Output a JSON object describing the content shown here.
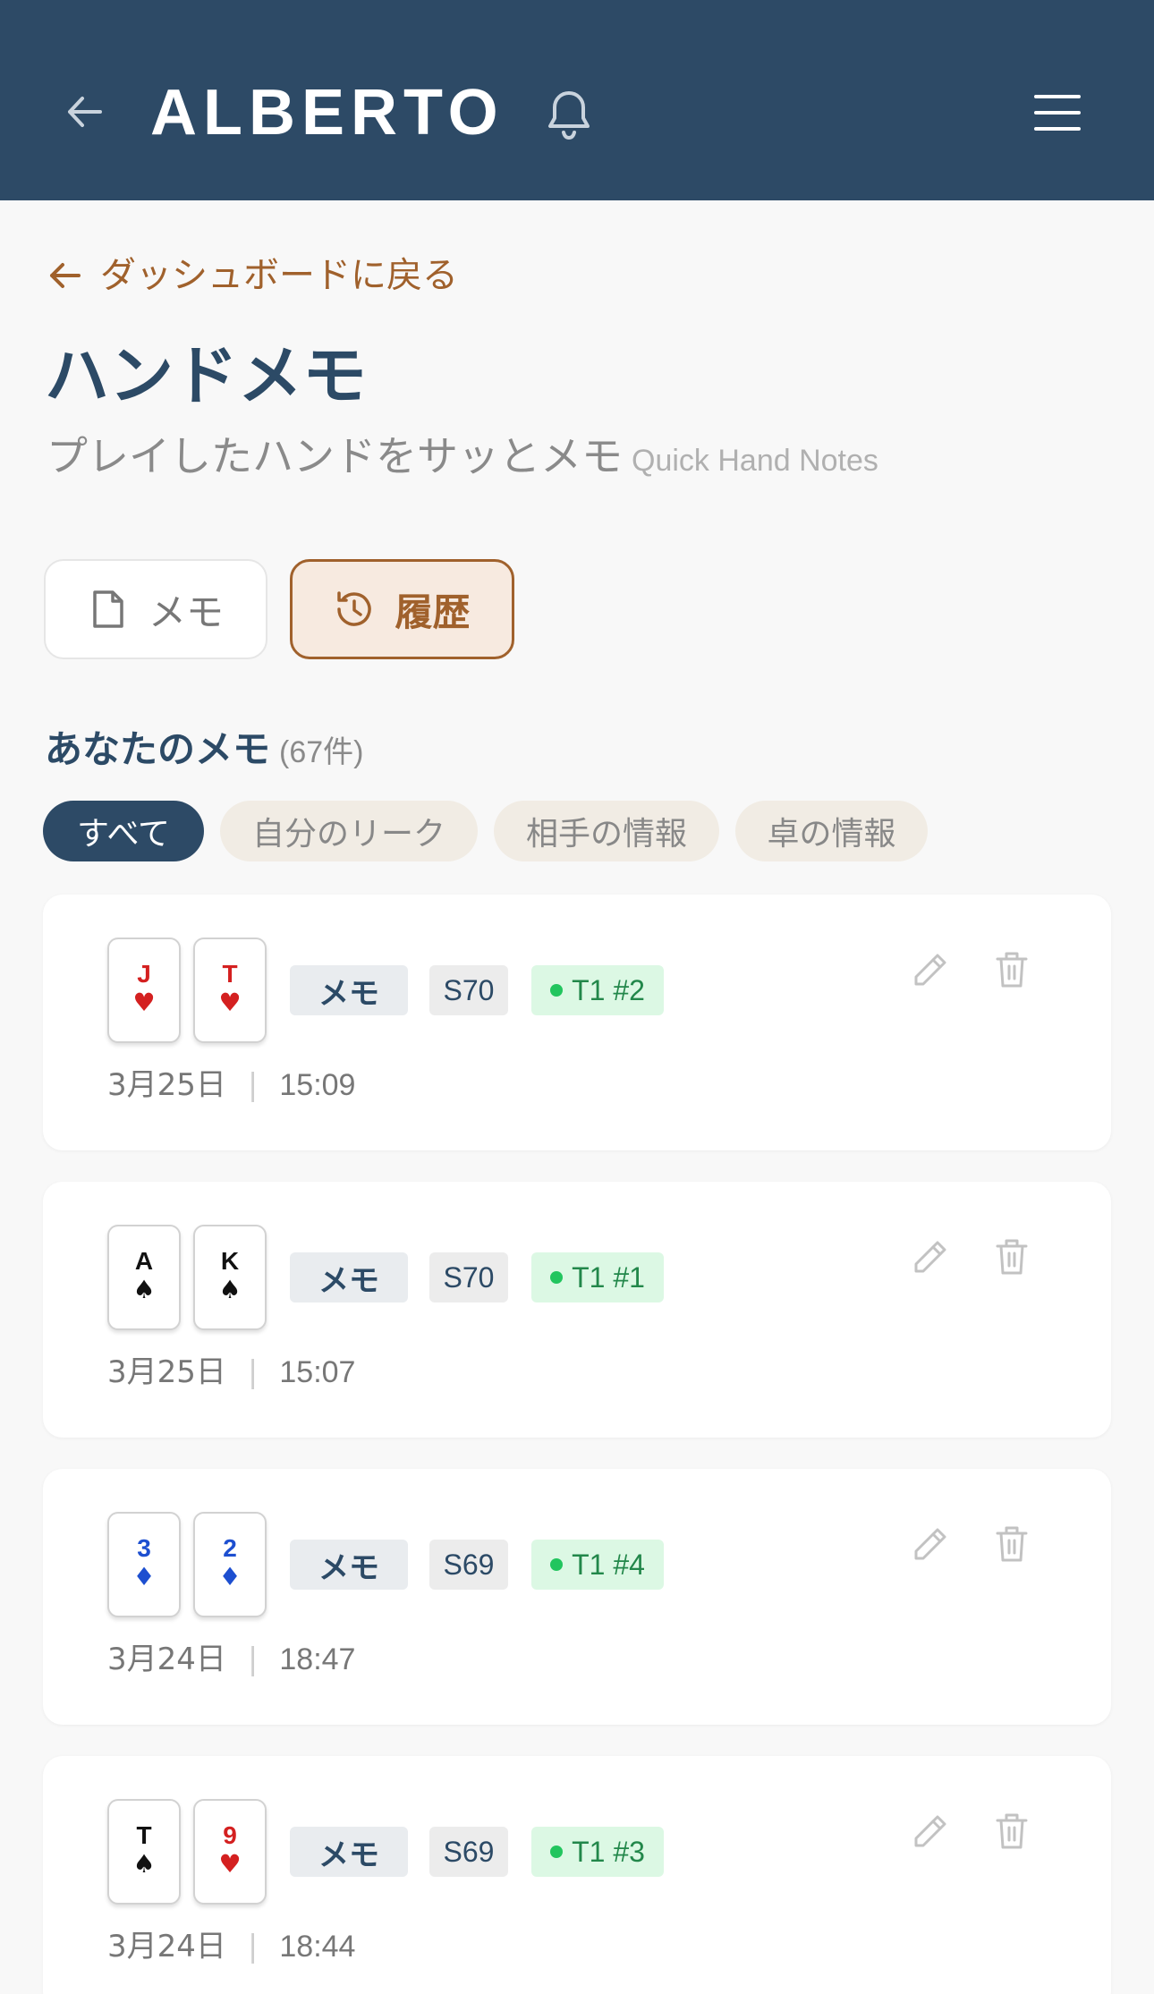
{
  "header": {
    "brand": "ALBERTO",
    "back_icon": "arrow-left-icon",
    "bell_icon": "bell-icon",
    "menu_icon": "hamburger-menu-icon"
  },
  "breadcrumb": {
    "label": "ダッシュボードに戻る"
  },
  "page": {
    "title": "ハンドメモ",
    "subtitle": "プレイしたハンドをサッとメモ",
    "subtitle_en": "Quick Hand Notes"
  },
  "tabs": [
    {
      "label": "メモ",
      "icon": "document-icon",
      "active": false
    },
    {
      "label": "履歴",
      "icon": "history-clock-icon",
      "active": true
    }
  ],
  "section": {
    "title": "あなたのメモ",
    "count": "(67件)"
  },
  "filters": [
    {
      "label": "すべて",
      "active": true
    },
    {
      "label": "自分のリーク",
      "active": false
    },
    {
      "label": "相手の情報",
      "active": false
    },
    {
      "label": "卓の情報",
      "active": false
    }
  ],
  "colors": {
    "header": "#2d4a66",
    "accent": "#a0612c",
    "red_suit": "#d42020",
    "diamond": "#1d4fd0",
    "table_green": "#22c55e"
  },
  "notes": [
    {
      "cards": [
        {
          "rank": "J",
          "suit": "♥"
        },
        {
          "rank": "T",
          "suit": "♥"
        }
      ],
      "type": "メモ",
      "session": "S70",
      "table": "T1 #2",
      "date": "3月25日",
      "separator": "|",
      "time": "15:09"
    },
    {
      "cards": [
        {
          "rank": "A",
          "suit": "♠"
        },
        {
          "rank": "K",
          "suit": "♠"
        }
      ],
      "type": "メモ",
      "session": "S70",
      "table": "T1 #1",
      "date": "3月25日",
      "separator": "|",
      "time": "15:07"
    },
    {
      "cards": [
        {
          "rank": "3",
          "suit": "♦"
        },
        {
          "rank": "2",
          "suit": "♦"
        }
      ],
      "type": "メモ",
      "session": "S69",
      "table": "T1 #4",
      "date": "3月24日",
      "separator": "|",
      "time": "18:47"
    },
    {
      "cards": [
        {
          "rank": "T",
          "suit": "♠"
        },
        {
          "rank": "9",
          "suit": "♥"
        }
      ],
      "type": "メモ",
      "session": "S69",
      "table": "T1 #3",
      "date": "3月24日",
      "separator": "|",
      "time": "18:44"
    }
  ]
}
